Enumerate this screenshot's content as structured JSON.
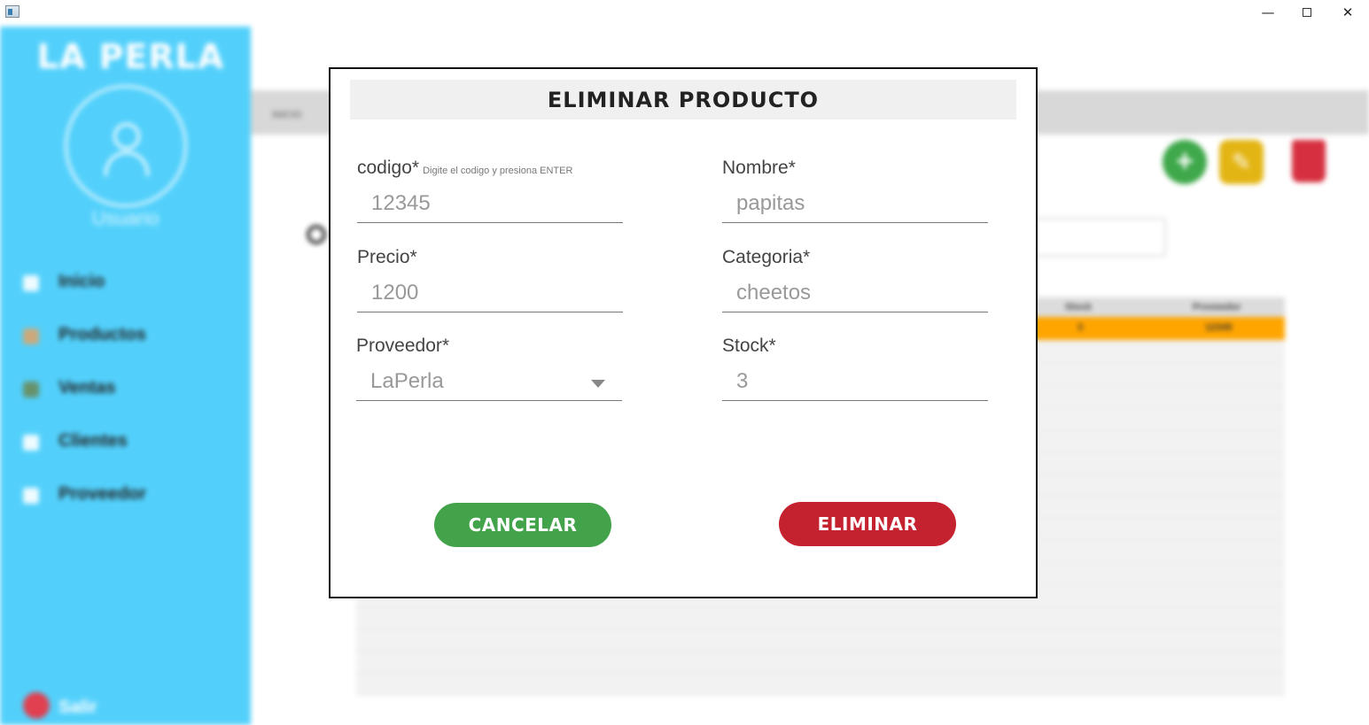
{
  "window": {
    "minimize": "—",
    "close": "✕"
  },
  "background": {
    "brand": "LA PERLA",
    "user_label": "Usuario",
    "nav": [
      {
        "label": "Inicio",
        "icon": "home-icon"
      },
      {
        "label": "Productos",
        "icon": "products-icon"
      },
      {
        "label": "Ventas",
        "icon": "sales-icon"
      },
      {
        "label": "Clientes",
        "icon": "clients-icon"
      },
      {
        "label": "Proveedor",
        "icon": "supplier-icon"
      }
    ],
    "logout": "Salir",
    "tab": "INICIO",
    "add_icon": "+",
    "edit_icon": "✎",
    "table": {
      "columns": [
        "Stock",
        "Proveedor"
      ],
      "selected_row": [
        "3",
        "12345"
      ],
      "selected_color": "#ffa500"
    }
  },
  "dialog": {
    "title": "ELIMINAR PRODUCTO",
    "fields": {
      "codigo": {
        "label": "codigo*",
        "hint": "Digite el codigo y presiona ENTER",
        "value": "12345"
      },
      "nombre": {
        "label": "Nombre*",
        "value": "papitas"
      },
      "precio": {
        "label": "Precio*",
        "value": "1200"
      },
      "categoria": {
        "label": "Categoria*",
        "value": "cheetos"
      },
      "proveedor": {
        "label": "Proveedor*",
        "value": "LaPerla"
      },
      "stock": {
        "label": "Stock*",
        "value": "3"
      }
    },
    "cancel_label": "CANCELAR",
    "delete_label": "ELIMINAR",
    "colors": {
      "cancel": "#43a34b",
      "delete": "#c5222f",
      "sidebar": "#52d0fb"
    }
  }
}
